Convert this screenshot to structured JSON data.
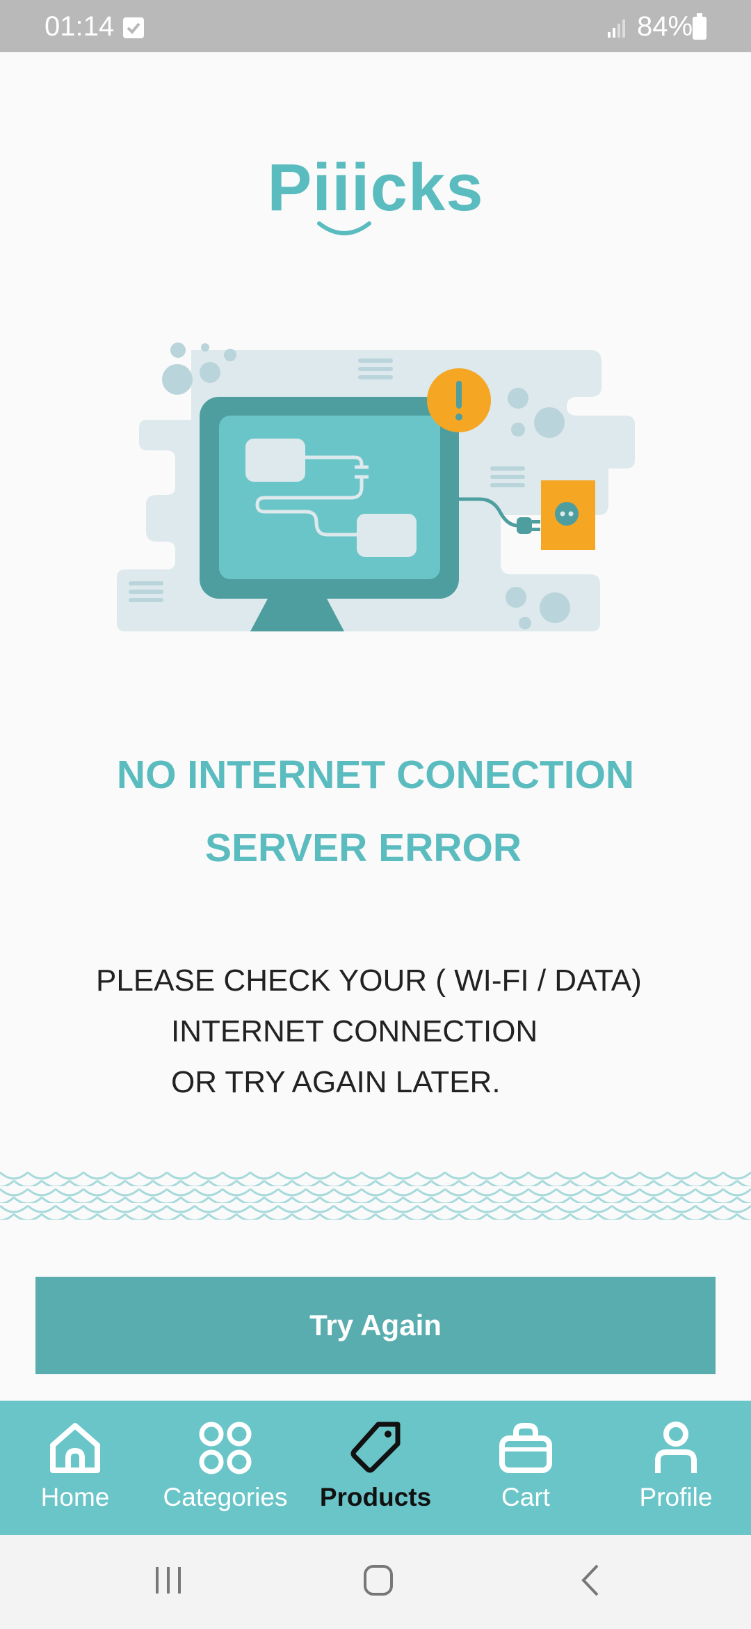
{
  "status_bar": {
    "time": "01:14",
    "battery": "84%"
  },
  "logo": {
    "text": "Piiicks"
  },
  "error": {
    "title": "NO INTERNET CONECTION",
    "subtitle": "SERVER ERROR",
    "message_lines": [
      "PLEASE CHECK YOUR ( WI-FI / DATA)",
      "INTERNET CONNECTION",
      "OR TRY AGAIN LATER."
    ]
  },
  "actions": {
    "try_again": "Try Again"
  },
  "bottom_nav": {
    "items": [
      {
        "label": "Home",
        "icon": "home-icon",
        "active": false
      },
      {
        "label": "Categories",
        "icon": "categories-icon",
        "active": false
      },
      {
        "label": "Products",
        "icon": "tag-icon",
        "active": true
      },
      {
        "label": "Cart",
        "icon": "shopping-bag-icon",
        "active": false
      },
      {
        "label": "Profile",
        "icon": "profile-icon",
        "active": false
      }
    ]
  },
  "system_nav": {
    "icons": [
      "recent-apps-icon",
      "home-circle-icon",
      "back-icon"
    ]
  },
  "colors": {
    "brand_teal": "#5bbcc0",
    "button_teal": "#5aadaf",
    "nav_teal": "#6ac5c8",
    "warning_orange": "#f5a623"
  }
}
